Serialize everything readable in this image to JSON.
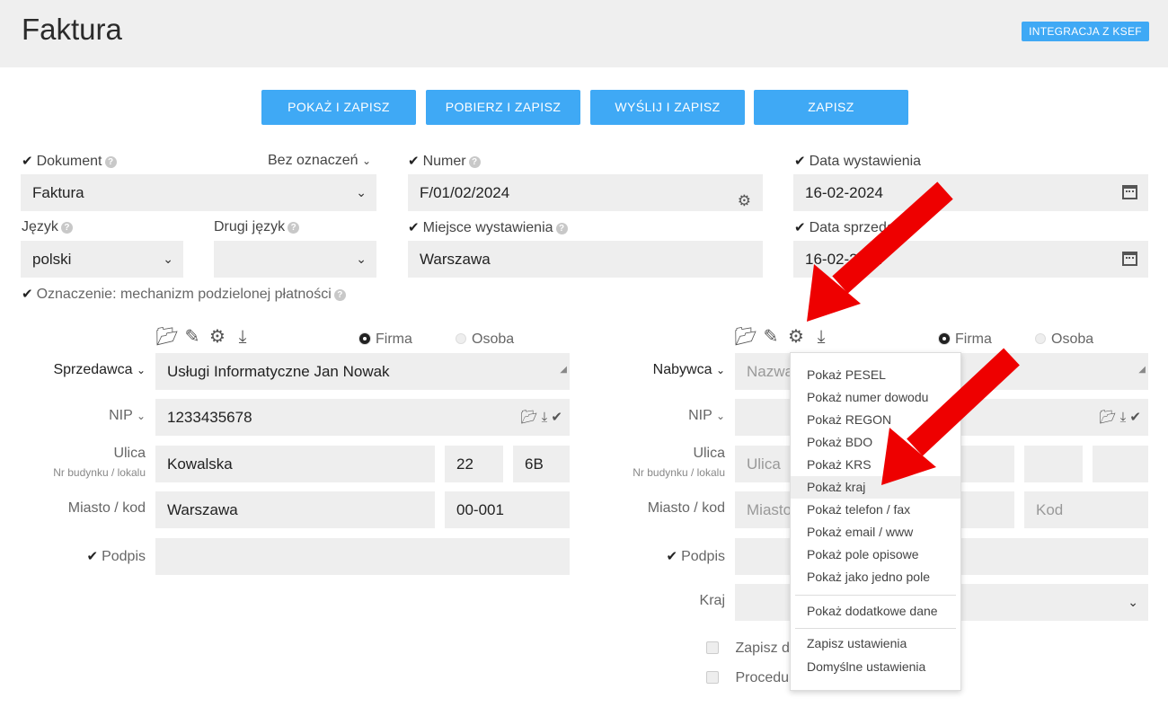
{
  "header": {
    "title": "Faktura",
    "ksef_button": "INTEGRACJA Z KSEF"
  },
  "actions": [
    "POKAŻ I ZAPISZ",
    "POBIERZ I ZAPISZ",
    "WYŚLIJ I ZAPISZ",
    "ZAPISZ"
  ],
  "document": {
    "label": "Dokument",
    "marking": "Bez oznaczeń",
    "value": "Faktura"
  },
  "number": {
    "label": "Numer",
    "value": "F/01/02/2024"
  },
  "issue_date": {
    "label": "Data wystawienia",
    "value": "16-02-2024"
  },
  "language": {
    "label": "Język",
    "value": "polski"
  },
  "second_language": {
    "label": "Drugi język",
    "value": ""
  },
  "place": {
    "label": "Miejsce wystawienia",
    "value": "Warszawa"
  },
  "sale_date": {
    "label": "Data sprzedaży",
    "value": "16-02-2024"
  },
  "split_payment": {
    "label": "Oznaczenie: mechanizm podzielonej płatności"
  },
  "party_types": {
    "company": "Firma",
    "person": "Osoba"
  },
  "seller": {
    "label": "Sprzedawca",
    "name": "Usługi Informatyczne Jan Nowak",
    "nip_label": "NIP",
    "nip": "1233435678",
    "street_label": "Ulica",
    "street_sub": "Nr budynku / lokalu",
    "street": "Kowalska",
    "building": "22",
    "unit": "6B",
    "city_label": "Miasto / kod",
    "city": "Warszawa",
    "postcode": "00-001",
    "signature_label": "Podpis"
  },
  "buyer": {
    "label": "Nabywca",
    "name_placeholder": "Nazwa",
    "nip_label": "NIP",
    "street_label": "Ulica",
    "street_sub": "Nr budynku / lokalu",
    "street_placeholder": "Ulica",
    "city_label": "Miasto / kod",
    "city_placeholder": "Miasto",
    "postcode_placeholder": "Kod",
    "signature_label": "Podpis",
    "country_label": "Kraj",
    "save_label": "Zapisz d",
    "procedure_label": "Procedu"
  },
  "dropdown_menu": {
    "items": [
      "Pokaż PESEL",
      "Pokaż numer dowodu",
      "Pokaż REGON",
      "Pokaż BDO",
      "Pokaż KRS",
      "Pokaż kraj",
      "Pokaż telefon / fax",
      "Pokaż email / www",
      "Pokaż pole opisowe",
      "Pokaż jako jedno pole"
    ],
    "extra": "Pokaż dodatkowe dane",
    "settings": [
      "Zapisz ustawienia",
      "Domyślne ustawienia"
    ],
    "highlighted": "Pokaż kraj"
  },
  "colors": {
    "accent": "#3fa9f5",
    "field_bg": "#eeeeee",
    "annotation_arrow": "#ee0000"
  }
}
